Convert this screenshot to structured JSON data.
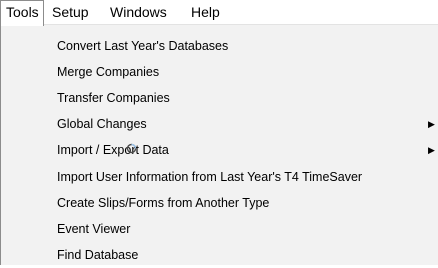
{
  "menubar": {
    "items": [
      {
        "label": "Tools"
      },
      {
        "label": "Setup"
      },
      {
        "label": "Windows"
      },
      {
        "label": "Help"
      }
    ]
  },
  "tools_menu": {
    "items": [
      {
        "label": "Convert Last Year's Databases",
        "submenu": false
      },
      {
        "label": "Merge Companies",
        "submenu": false
      },
      {
        "label": "Transfer Companies",
        "submenu": false
      },
      {
        "label": "Global Changes",
        "submenu": true,
        "arrow": "▶"
      },
      {
        "label": "Import / Export Data",
        "submenu": true,
        "arrow": "▶"
      },
      {
        "label": "Import User Information from Last Year's T4 TimeSaver",
        "submenu": false
      },
      {
        "label": "Create Slips/Forms from Another Type",
        "submenu": false
      },
      {
        "label": "Event Viewer",
        "submenu": false
      },
      {
        "label": "Find Database",
        "submenu": false
      }
    ]
  },
  "cursor": {
    "icon": "busy-cursor-icon"
  }
}
